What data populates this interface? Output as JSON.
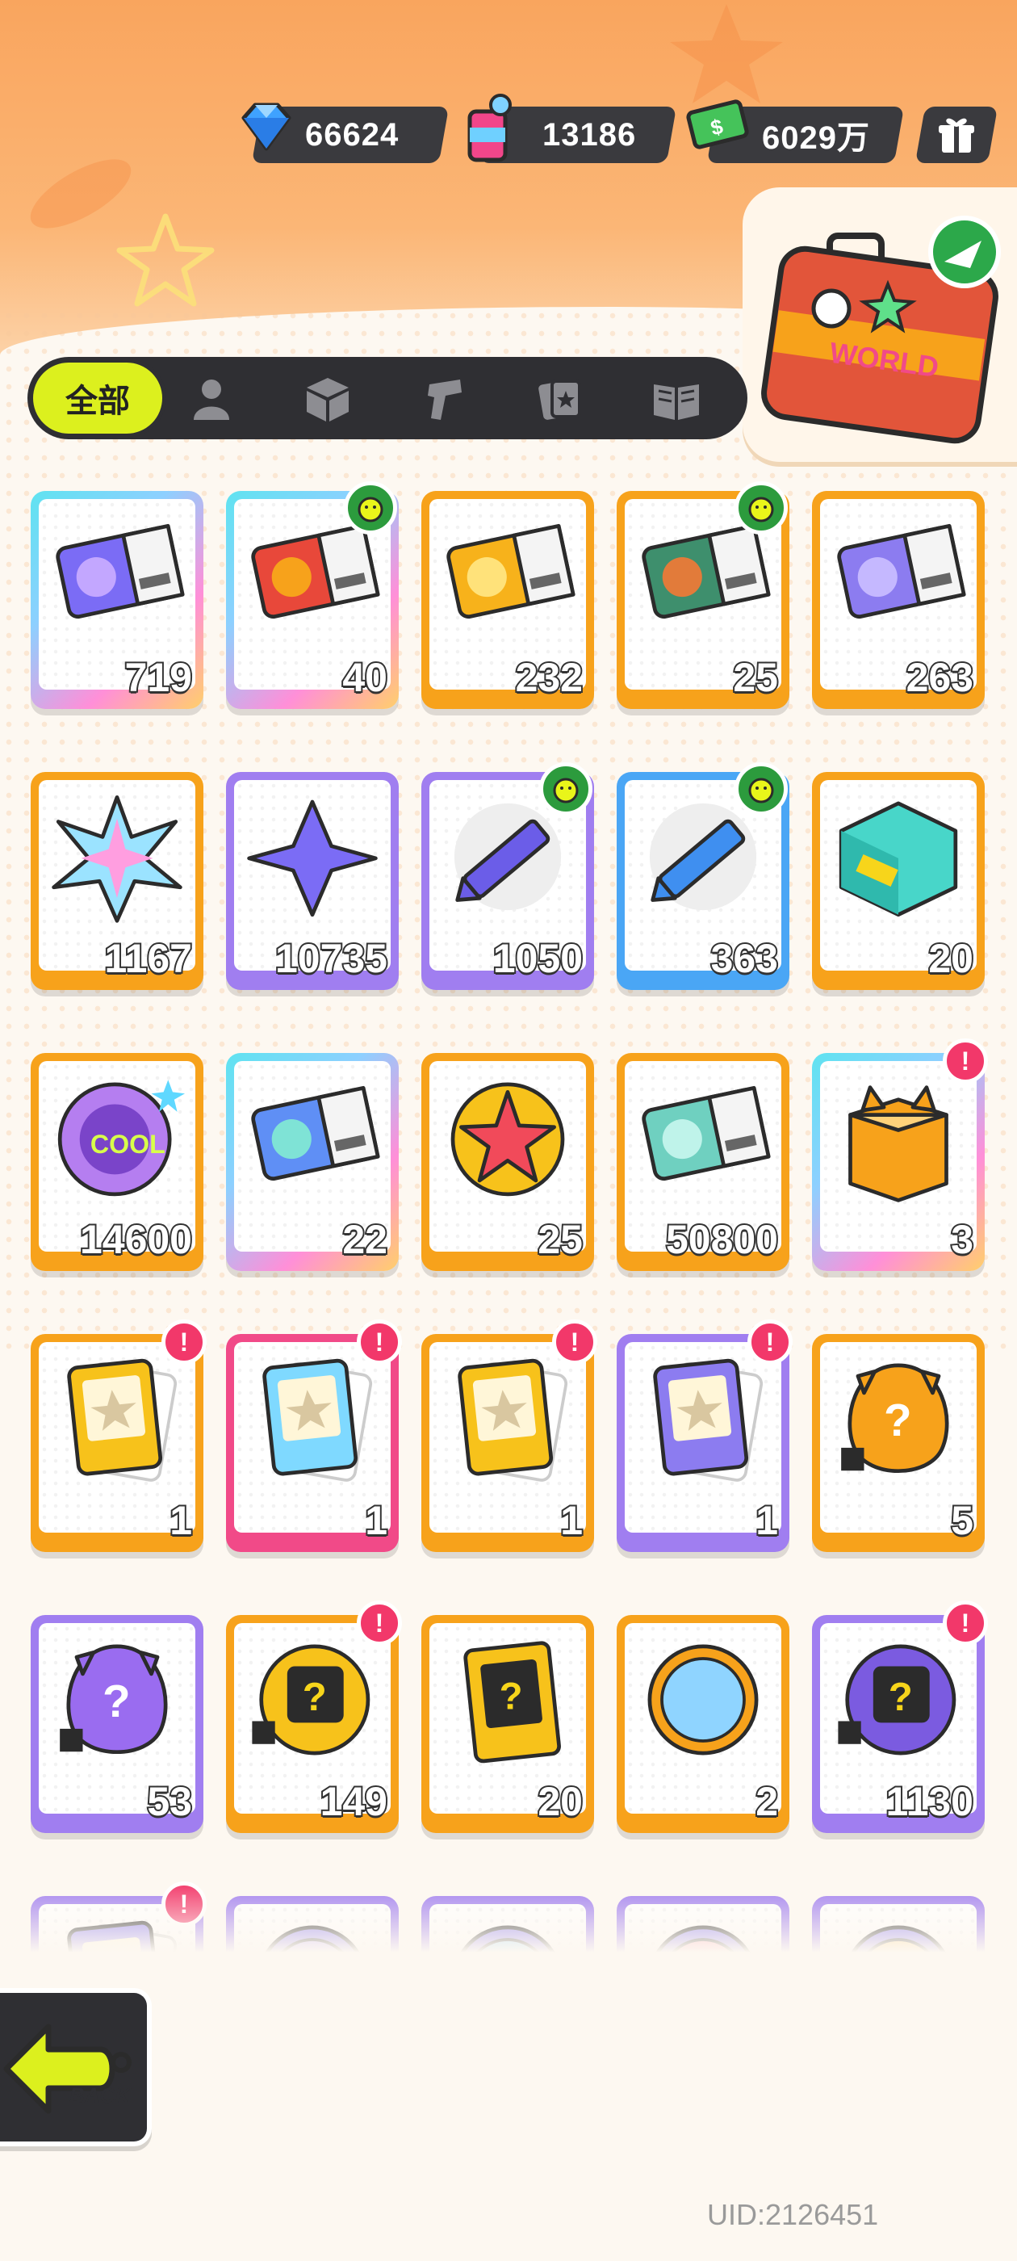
{
  "currencies": [
    {
      "id": "diamond",
      "value": "66624",
      "icon": "diamond-icon"
    },
    {
      "id": "paint",
      "value": "13186",
      "icon": "paint-can-icon"
    },
    {
      "id": "cash",
      "value": "6029万",
      "icon": "cash-icon"
    }
  ],
  "gift_icon": "gift-icon",
  "suitcase": {
    "icon": "suitcase-world-icon",
    "label": "WORLD"
  },
  "tabs": [
    {
      "label": "全部",
      "icon": "all-tab",
      "selected": true
    },
    {
      "label": "",
      "icon": "person-icon"
    },
    {
      "label": "",
      "icon": "box-icon"
    },
    {
      "label": "",
      "icon": "spray-gun-icon"
    },
    {
      "label": "",
      "icon": "cards-icon"
    },
    {
      "label": "",
      "icon": "book-icon"
    }
  ],
  "items": [
    {
      "art": "purple-ticket",
      "count": "719",
      "border": "rainbow",
      "badge": ""
    },
    {
      "art": "lion-dance-ticket",
      "count": "40",
      "border": "rainbow",
      "badge": "bird"
    },
    {
      "art": "gold-ticket",
      "count": "232",
      "border": "orange",
      "badge": ""
    },
    {
      "art": "green-ticket",
      "count": "25",
      "border": "orange",
      "badge": "bird"
    },
    {
      "art": "violet-ticket",
      "count": "263",
      "border": "orange",
      "badge": ""
    },
    {
      "art": "rainbow-star",
      "count": "1167",
      "border": "orange",
      "badge": ""
    },
    {
      "art": "purple-star",
      "count": "10735",
      "border": "purple",
      "badge": ""
    },
    {
      "art": "purple-crayon",
      "count": "1050",
      "border": "purple",
      "badge": "bird"
    },
    {
      "art": "blue-crayon",
      "count": "363",
      "border": "blue",
      "badge": "bird"
    },
    {
      "art": "color-block",
      "count": "20",
      "border": "orange",
      "badge": ""
    },
    {
      "art": "cool-badge",
      "count": "14600",
      "border": "orange",
      "badge": ""
    },
    {
      "art": "lottery-ticket",
      "count": "22",
      "border": "rainbow",
      "badge": ""
    },
    {
      "art": "star-badge",
      "count": "25",
      "border": "orange",
      "badge": ""
    },
    {
      "art": "season-ticket",
      "count": "50800",
      "border": "orange",
      "badge": ""
    },
    {
      "art": "cat-box",
      "count": "3",
      "border": "rainbow",
      "badge": "alert"
    },
    {
      "art": "gold-travel-card",
      "count": "1",
      "border": "orange",
      "badge": "alert"
    },
    {
      "art": "rainbow-travel-card",
      "count": "1",
      "border": "pink",
      "badge": "alert"
    },
    {
      "art": "gold-travel-card-2",
      "count": "1",
      "border": "orange",
      "badge": "alert"
    },
    {
      "art": "purple-travel-card",
      "count": "1",
      "border": "purple",
      "badge": "alert"
    },
    {
      "art": "gold-mystery-egg",
      "count": "5",
      "border": "orange",
      "badge": ""
    },
    {
      "art": "purple-mystery-egg",
      "count": "53",
      "border": "purple",
      "badge": ""
    },
    {
      "art": "deity-mystery-gold",
      "count": "149",
      "border": "orange",
      "badge": "alert"
    },
    {
      "art": "travel-mystery-card",
      "count": "20",
      "border": "orange",
      "badge": ""
    },
    {
      "art": "bunny-coin",
      "count": "2",
      "border": "orange",
      "badge": ""
    },
    {
      "art": "deity-mystery-purple",
      "count": "1130",
      "border": "purple",
      "badge": "alert"
    },
    {
      "art": "partial-card",
      "count": "",
      "border": "purple",
      "badge": "alert"
    },
    {
      "art": "partial-coin-purple",
      "count": "",
      "border": "purple",
      "badge": ""
    },
    {
      "art": "partial-coin-blue",
      "count": "",
      "border": "purple",
      "badge": ""
    },
    {
      "art": "partial-coin-pink",
      "count": "",
      "border": "purple",
      "badge": ""
    },
    {
      "art": "partial-coin-gold",
      "count": "",
      "border": "purple",
      "badge": ""
    }
  ],
  "back_button": {
    "label": "BACK",
    "icon": "back-arrow-icon"
  },
  "uid": "UID:2126451",
  "colors": {
    "accent": "#dcf01e",
    "orange": "#f7a21b",
    "purple": "#a07ef0",
    "pink": "#f14a88",
    "dark": "#2f2f33"
  }
}
